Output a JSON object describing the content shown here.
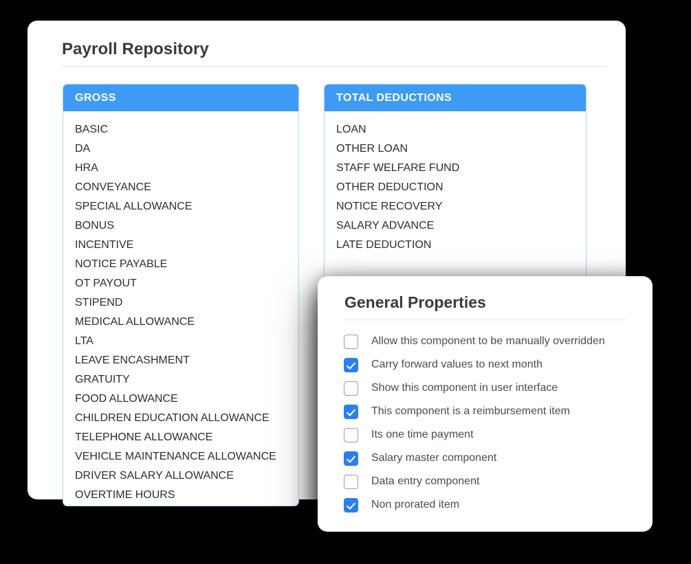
{
  "page": {
    "title": "Payroll Repository"
  },
  "panels": [
    {
      "id": "gross",
      "header": "GROSS",
      "items": [
        "BASIC",
        "DA",
        "HRA",
        "CONVEYANCE",
        "SPECIAL ALLOWANCE",
        "BONUS",
        "INCENTIVE",
        "NOTICE PAYABLE",
        "OT PAYOUT",
        "STIPEND",
        "MEDICAL ALLOWANCE",
        "LTA",
        "LEAVE ENCASHMENT",
        "GRATUITY",
        "FOOD ALLOWANCE",
        "CHILDREN EDUCATION ALLOWANCE",
        "TELEPHONE ALLOWANCE",
        "VEHICLE MAINTENANCE ALLOWANCE",
        "DRIVER SALARY ALLOWANCE",
        "OVERTIME HOURS"
      ]
    },
    {
      "id": "deductions",
      "header": "TOTAL DEDUCTIONS",
      "items": [
        "LOAN",
        "OTHER LOAN",
        "STAFF WELFARE FUND",
        "OTHER DEDUCTION",
        "NOTICE RECOVERY",
        "SALARY ADVANCE",
        "LATE DEDUCTION"
      ]
    }
  ],
  "properties_panel": {
    "title": "General Properties",
    "options": [
      {
        "label": "Allow this component to be manually overridden",
        "checked": false
      },
      {
        "label": "Carry forward values to next month",
        "checked": true
      },
      {
        "label": "Show this component in user interface",
        "checked": false
      },
      {
        "label": "This component is a reimbursement item",
        "checked": true
      },
      {
        "label": "Its one time payment",
        "checked": false
      },
      {
        "label": "Salary master component",
        "checked": true
      },
      {
        "label": "Data entry component",
        "checked": false
      },
      {
        "label": "Non prorated item",
        "checked": true
      }
    ]
  },
  "colors": {
    "accent_blue": "#3d9bf5",
    "checkbox_blue": "#2b7fec",
    "panel_border": "#aed5f7",
    "text_dark": "#2d2d2d",
    "background": "#000000"
  }
}
